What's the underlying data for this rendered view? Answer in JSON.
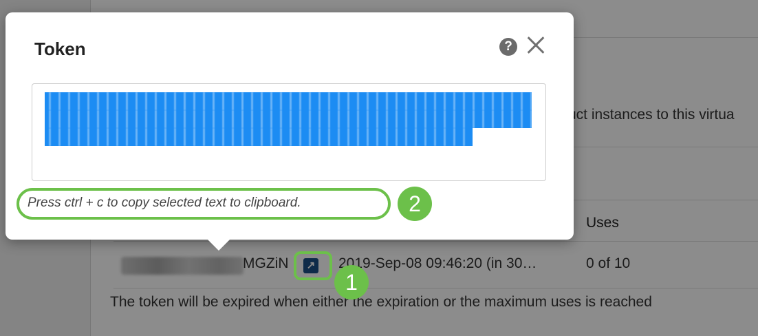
{
  "background": {
    "description_snippet": "uct instances to this virtua",
    "table": {
      "uses_header": "Uses",
      "row": {
        "token_tail": "MGZiN",
        "expires": "2019-Sep-08 09:46:20 (in 30…",
        "uses": "0 of 10"
      }
    },
    "note": "The token will be expired when either the expiration or the maximum uses is reached"
  },
  "modal": {
    "title": "Token",
    "help_icon": "question-circle",
    "close_icon": "close-x",
    "hint": "Press ctrl + c to copy selected text to clipboard."
  },
  "annotations": {
    "step1": "1",
    "step2": "2",
    "accent_color": "#6cc04a",
    "selection_color": "#1c8cf3"
  }
}
